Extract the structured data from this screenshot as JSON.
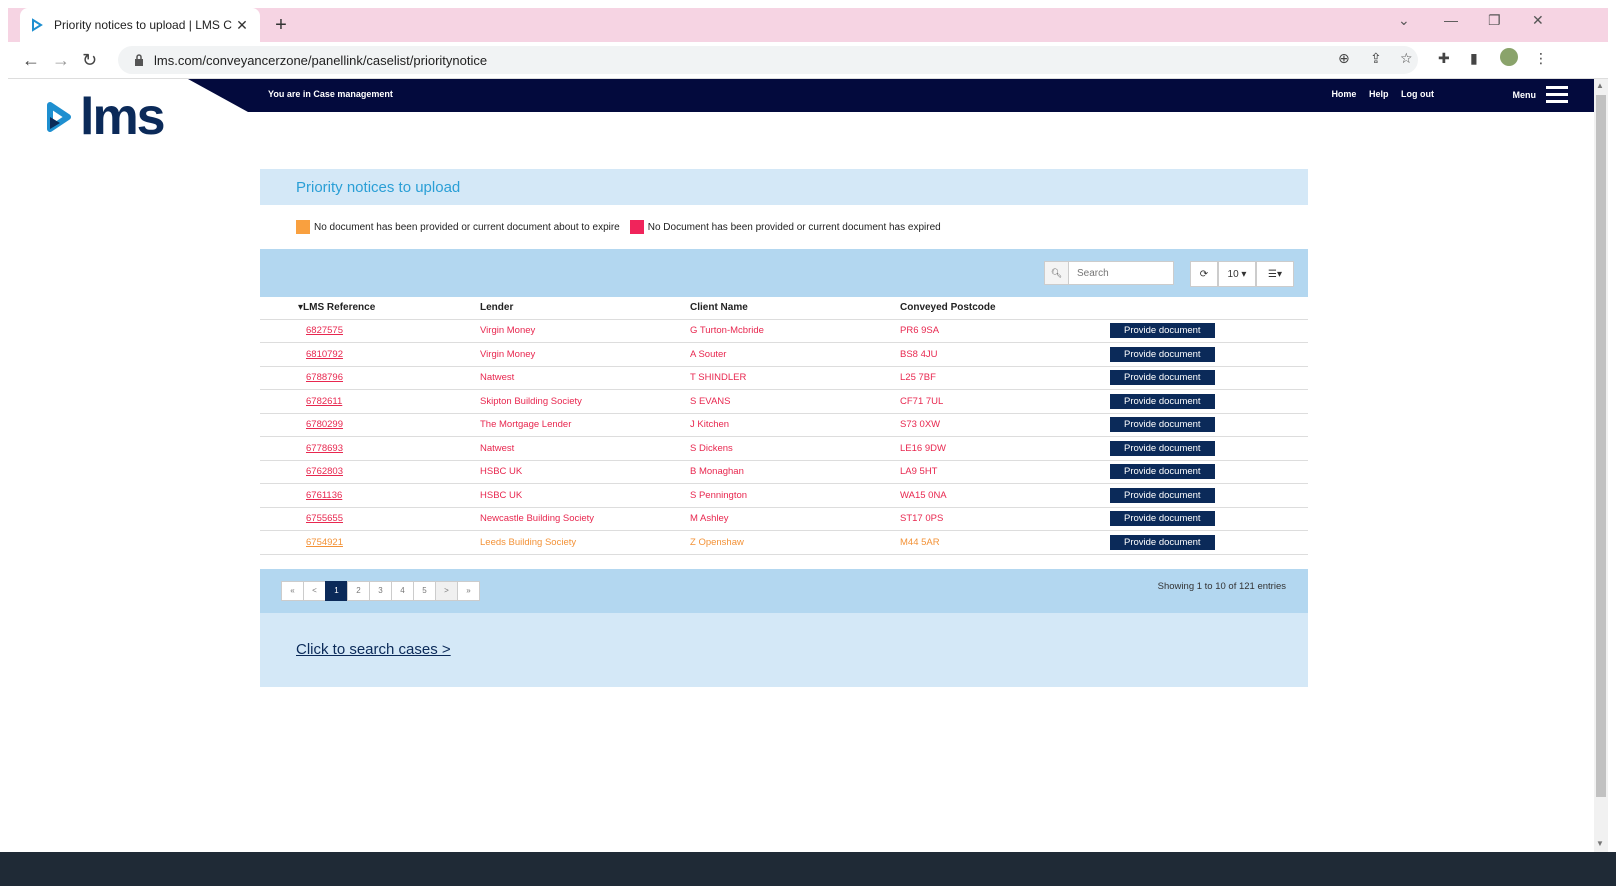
{
  "browser": {
    "tab_title": "Priority notices to upload | LMS C",
    "url": "lms.com/conveyancerzone/panellink/caselist/prioritynotice"
  },
  "header": {
    "logo_text": "lms",
    "location": "You are in Case management",
    "links": [
      "Home",
      "Help",
      "Log out"
    ],
    "menu_label": "Menu"
  },
  "page": {
    "title": "Priority notices to upload",
    "legend": {
      "orange": "No document has been provided or current document about to expire",
      "red": "No Document has been provided or current document has expired"
    },
    "search_placeholder": "Search",
    "page_size": "10",
    "columns": [
      "LMS Reference",
      "Lender",
      "Client Name",
      "Conveyed Postcode"
    ],
    "rows": [
      {
        "ref": "6827575",
        "lender": "Virgin Money",
        "client": "G Turton-Mcbride",
        "postcode": "PR6 9SA",
        "status": "red"
      },
      {
        "ref": "6810792",
        "lender": "Virgin Money",
        "client": "A Souter",
        "postcode": "BS8 4JU",
        "status": "red"
      },
      {
        "ref": "6788796",
        "lender": "Natwest",
        "client": "T SHINDLER",
        "postcode": "L25 7BF",
        "status": "red"
      },
      {
        "ref": "6782611",
        "lender": "Skipton Building Society",
        "client": "S EVANS",
        "postcode": "CF71 7UL",
        "status": "red"
      },
      {
        "ref": "6780299",
        "lender": "The Mortgage Lender",
        "client": "J Kitchen",
        "postcode": "S73 0XW",
        "status": "red"
      },
      {
        "ref": "6778693",
        "lender": "Natwest",
        "client": "S Dickens",
        "postcode": "LE16 9DW",
        "status": "red"
      },
      {
        "ref": "6762803",
        "lender": "HSBC UK",
        "client": "B Monaghan",
        "postcode": "LA9 5HT",
        "status": "red"
      },
      {
        "ref": "6761136",
        "lender": "HSBC UK",
        "client": "S Pennington",
        "postcode": "WA15 0NA",
        "status": "red"
      },
      {
        "ref": "6755655",
        "lender": "Newcastle Building Society",
        "client": "M Ashley",
        "postcode": "ST17 0PS",
        "status": "red"
      },
      {
        "ref": "6754921",
        "lender": "Leeds Building Society",
        "client": "Z Openshaw",
        "postcode": "M44 5AR",
        "status": "orange"
      }
    ],
    "row_button": "Provide document",
    "pager": [
      "«",
      "<",
      "1",
      "2",
      "3",
      "4",
      "5",
      ">",
      "»"
    ],
    "showing": "Showing 1 to 10 of 121 entries",
    "search_cases": "Click to search cases >"
  },
  "colors": {
    "navy": "#0b2a59",
    "red_status": "#e8274f",
    "orange_status": "#f39237",
    "light_blue": "#b3d7f0",
    "pale_blue": "#d4e8f7"
  }
}
